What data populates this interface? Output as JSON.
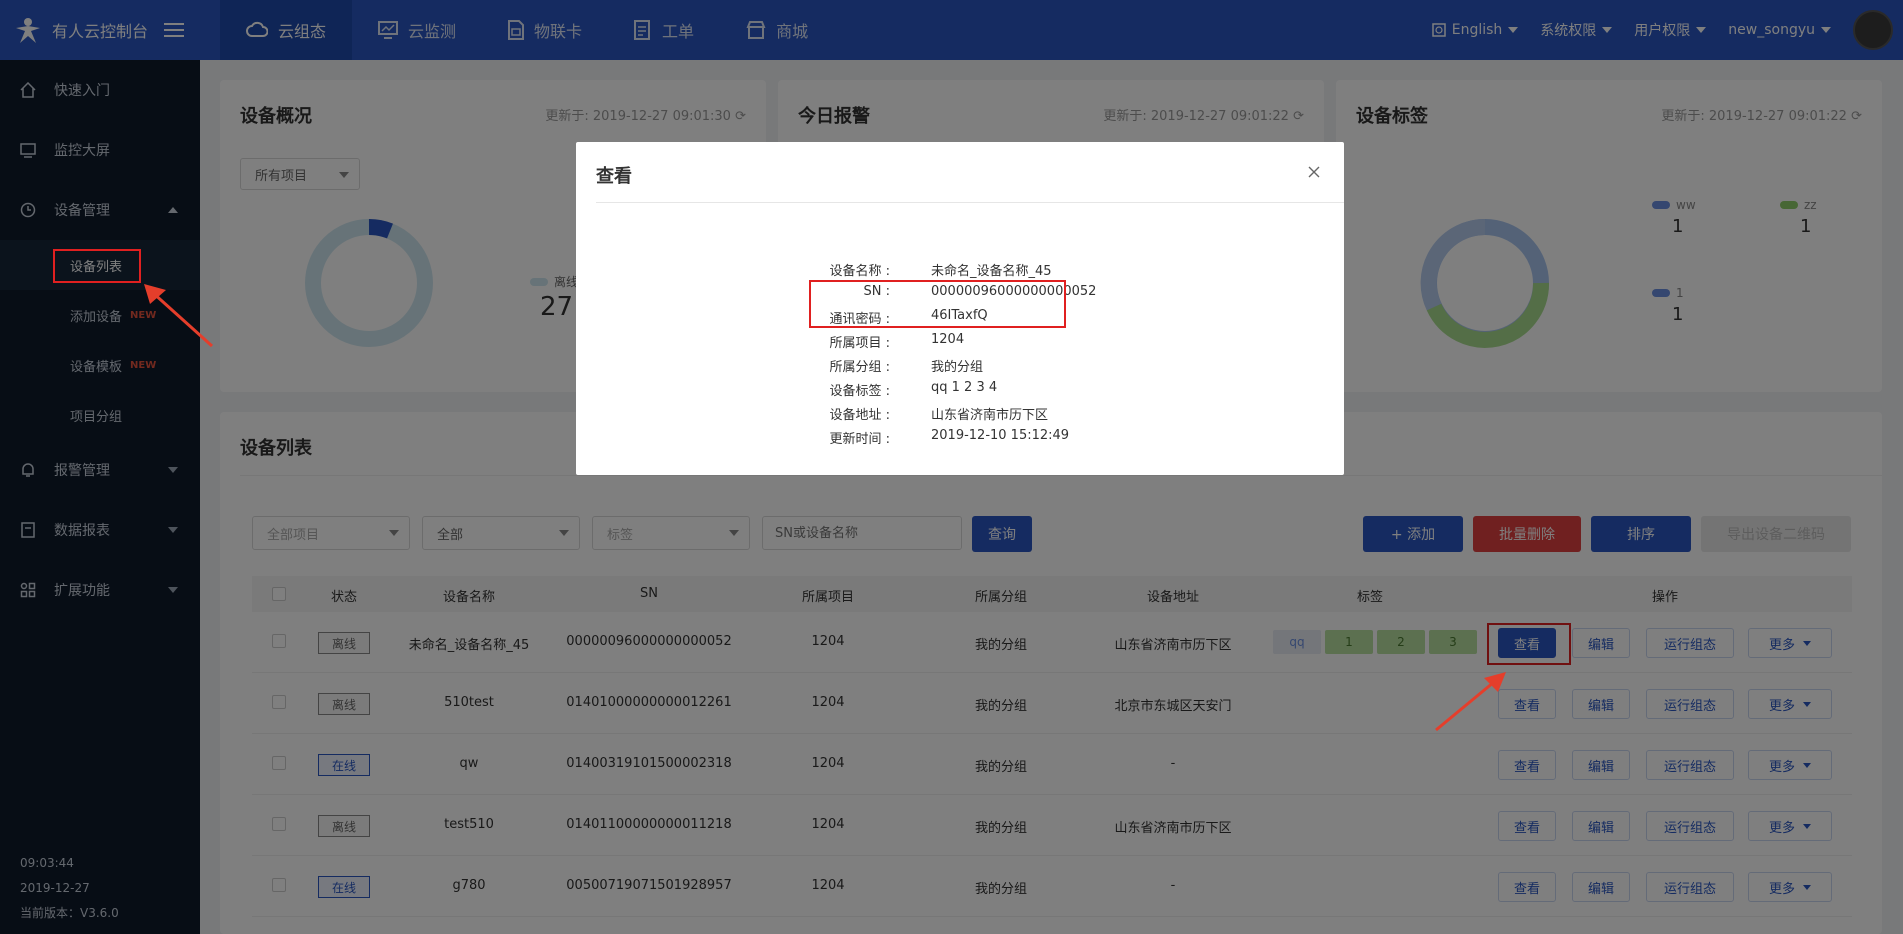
{
  "app": {
    "title": "有人云控制台"
  },
  "nav": [
    {
      "label": "云组态",
      "active": true
    },
    {
      "label": "云监测"
    },
    {
      "label": "物联卡"
    },
    {
      "label": "工单"
    },
    {
      "label": "商城"
    }
  ],
  "top_right": {
    "language": "English",
    "sys_perm": "系统权限",
    "user_perm": "用户权限",
    "username": "new_songyu"
  },
  "sidebar": {
    "items": [
      {
        "label": "快速入门"
      },
      {
        "label": "监控大屏"
      },
      {
        "label": "设备管理"
      },
      {
        "label": "报警管理"
      },
      {
        "label": "数据报表"
      },
      {
        "label": "扩展功能"
      }
    ],
    "sub": [
      {
        "label": "设备列表"
      },
      {
        "label": "添加设备",
        "badge": "NEW"
      },
      {
        "label": "设备模板",
        "badge": "NEW"
      },
      {
        "label": "项目分组"
      }
    ],
    "footer": {
      "time": "09:03:44",
      "date": "2019-12-27",
      "version": "当前版本：V3.6.0"
    }
  },
  "cards": {
    "overview": {
      "title": "设备概况",
      "updated": "更新于: 2019-12-27 09:01:30",
      "select": "所有项目",
      "legend_label": "离线",
      "legend_value": "27"
    },
    "alarms": {
      "title": "今日报警",
      "updated": "更新于: 2019-12-27 09:01:22"
    },
    "tags": {
      "title": "设备标签",
      "updated": "更新于: 2019-12-27 09:01:22",
      "legend": [
        {
          "name": "ww",
          "value": "1",
          "color": "#6b8fe0"
        },
        {
          "name": "zz",
          "value": "1",
          "color": "#8fcf6a"
        },
        {
          "name": "1",
          "value": "1",
          "color": "#6b8fe0"
        }
      ]
    }
  },
  "device_list": {
    "title": "设备列表",
    "filters": {
      "project": "全部项目",
      "status": "全部",
      "tag": "标签",
      "search_placeholder": "SN或设备名称",
      "query": "查询"
    },
    "buttons": {
      "add": "+ 添加",
      "batch_delete": "批量删除",
      "sort": "排序",
      "export": "导出设备二维码"
    },
    "columns": [
      "状态",
      "设备名称",
      "SN",
      "所属项目",
      "所属分组",
      "设备地址",
      "标签",
      "操作"
    ],
    "rows": [
      {
        "status": "离线",
        "online": false,
        "name": "未命名_设备名称_45",
        "sn": "00000096000000000052",
        "project": "1204",
        "group": "我的分组",
        "address": "山东省济南市历下区",
        "tags": [
          "qq",
          "1",
          "2",
          "3"
        ]
      },
      {
        "status": "离线",
        "online": false,
        "name": "510test",
        "sn": "01401000000000012261",
        "project": "1204",
        "group": "我的分组",
        "address": "北京市东城区天安门",
        "tags": []
      },
      {
        "status": "在线",
        "online": true,
        "name": "qw",
        "sn": "01400319101500002318",
        "project": "1204",
        "group": "我的分组",
        "address": "-",
        "tags": []
      },
      {
        "status": "离线",
        "online": false,
        "name": "test510",
        "sn": "01401100000000011218",
        "project": "1204",
        "group": "我的分组",
        "address": "山东省济南市历下区",
        "tags": []
      },
      {
        "status": "在线",
        "online": true,
        "name": "g780",
        "sn": "00500719071501928957",
        "project": "1204",
        "group": "我的分组",
        "address": "-",
        "tags": []
      }
    ],
    "actions": {
      "view": "查看",
      "edit": "编辑",
      "run": "运行组态",
      "more": "更多"
    }
  },
  "modal": {
    "title": "查看",
    "fields": [
      {
        "k": "设备名称 :",
        "v": "未命名_设备名称_45"
      },
      {
        "k": "SN :",
        "v": "00000096000000000052"
      },
      {
        "k": "通讯密码 :",
        "v": "46ITaxfQ"
      },
      {
        "k": "所属项目 :",
        "v": "1204"
      },
      {
        "k": "所属分组 :",
        "v": "我的分组"
      },
      {
        "k": "设备标签 :",
        "v": "qq 1 2 3 4"
      },
      {
        "k": "设备地址 :",
        "v": "山东省济南市历下区"
      },
      {
        "k": "更新时间 :",
        "v": "2019-12-10 15:12:49"
      }
    ]
  },
  "colors": {
    "brand": "#2a57c2",
    "sidebar": "#0e1a2b",
    "danger": "#e04040",
    "highlight": "#e02020"
  }
}
